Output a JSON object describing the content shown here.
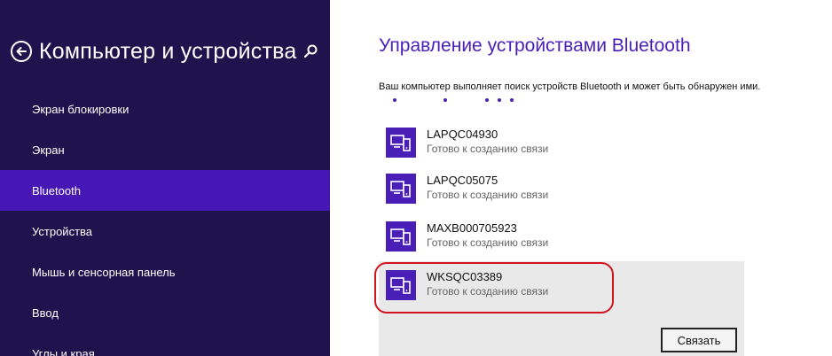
{
  "sidebar": {
    "title": "Компьютер и устройства",
    "back_icon": "back-arrow-circle-icon",
    "search_icon": "search-icon",
    "items": [
      {
        "label": "Экран блокировки"
      },
      {
        "label": "Экран"
      },
      {
        "label": "Bluetooth",
        "active": true
      },
      {
        "label": "Устройства"
      },
      {
        "label": "Мышь и сенсорная панель"
      },
      {
        "label": "Ввод"
      },
      {
        "label": "Углы и края"
      }
    ]
  },
  "main": {
    "title": "Управление устройствами Bluetooth",
    "status": "Ваш компьютер выполняет поиск устройств Bluetooth и может быть обнаружен ими.",
    "devices": [
      {
        "name": "LAPQC04930",
        "status": "Готово к созданию связи"
      },
      {
        "name": "LAPQC05075",
        "status": "Готово к созданию связи"
      },
      {
        "name": "MAXB000705923",
        "status": "Готово к созданию связи"
      },
      {
        "name": "WKSQC03389",
        "status": "Готово к созданию связи",
        "selected": true
      }
    ],
    "pair_button": "Связать"
  },
  "colors": {
    "sidebar_bg": "#20124d",
    "active_item_bg": "#4617b4",
    "accent": "#4a1fb8",
    "highlight": "#d3131e",
    "selected_bg": "#e9e9e9"
  }
}
